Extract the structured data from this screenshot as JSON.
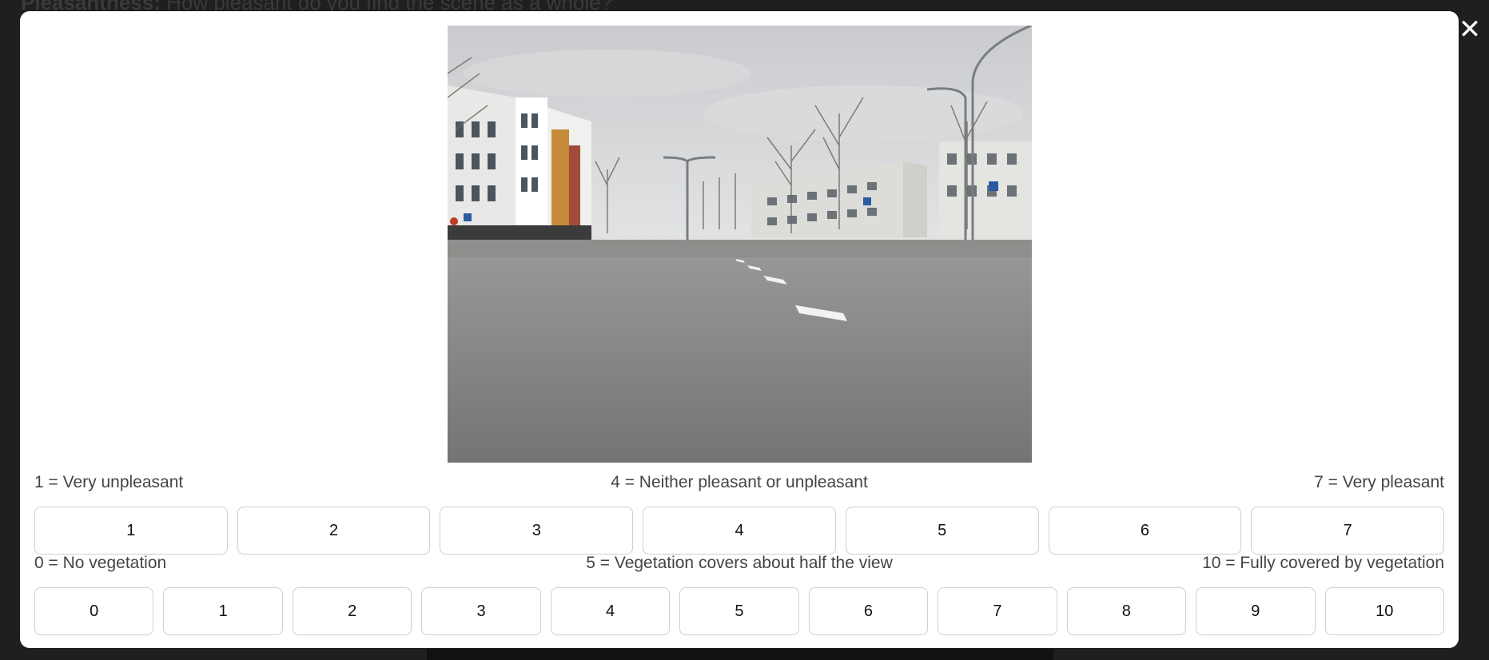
{
  "background": {
    "question_bold": "Pleasantness:",
    "question_text": "How pleasant do you find the scene as a whole?"
  },
  "close_glyph": "✕",
  "photo": {
    "description_icon": "street-photo"
  },
  "pleasantness_scale": {
    "left_label": "1 = Very unpleasant",
    "mid_label": "4 = Neither pleasant or unpleasant",
    "right_label": "7 = Very pleasant",
    "options": [
      "1",
      "2",
      "3",
      "4",
      "5",
      "6",
      "7"
    ]
  },
  "vegetation_scale": {
    "left_label": "0 = No vegetation",
    "mid_label": "5 = Vegetation covers about half the view",
    "right_label": "10 = Fully covered by vegetation",
    "options": [
      "0",
      "1",
      "2",
      "3",
      "4",
      "5",
      "6",
      "7",
      "8",
      "9",
      "10"
    ]
  },
  "colors": {
    "overlay": "#1f1f1f",
    "modal": "#ffffff",
    "button_border": "#cfcfcf"
  }
}
